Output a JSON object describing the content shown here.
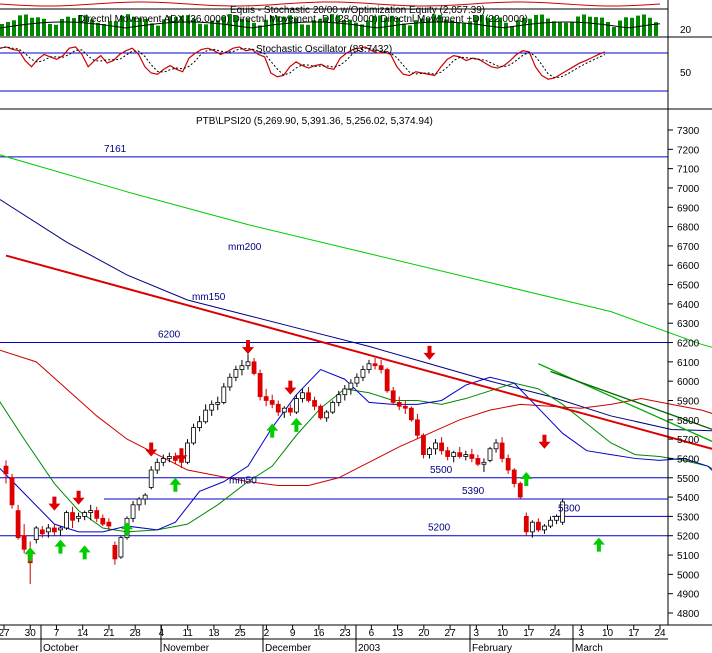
{
  "panels": {
    "equity": {
      "title": "Equis - Stochastic 20/00  w/Optimization Equity (2,057.39)",
      "adx_title": "Directnl Movement ADX (36.0000) Directnl Movement -DI (28.0000) Directnl Movement +DI (22.0000)",
      "tick_label": "20"
    },
    "stochastic": {
      "title": "Stochastic Oscillator (83.7432)",
      "tick_label": "50"
    },
    "price": {
      "title": "PTB\\LPSI20 (5,269.90, 5,391.36, 5,256.02, 5,374.94)"
    }
  },
  "chart_data": {
    "type": "candlestick",
    "title": "PTB\\LPSI20 (5,269.90, 5,391.36, 5,256.02, 5,374.94)",
    "ylim": [
      4750,
      7450
    ],
    "y_ticks": [
      4800,
      4900,
      5000,
      5100,
      5200,
      5300,
      5400,
      5500,
      5600,
      5700,
      5800,
      5900,
      6000,
      6100,
      6200,
      6300,
      6400,
      6500,
      6600,
      6700,
      6800,
      6900,
      7000,
      7100,
      7200,
      7300
    ],
    "x_ticks": [
      "27",
      "30",
      "7",
      "14",
      "21",
      "28",
      "4",
      "11",
      "18",
      "25",
      "2",
      "9",
      "16",
      "23",
      "6",
      "13",
      "20",
      "27",
      "3",
      "10",
      "17",
      "24",
      "3",
      "10",
      "17",
      "24"
    ],
    "x_month_labels": [
      "October",
      "November",
      "December",
      "2003",
      "February",
      "March"
    ],
    "horizontal_levels": [
      {
        "value": 7161,
        "label": "7161"
      },
      {
        "value": 6200,
        "label": "6200"
      },
      {
        "value": 5500,
        "label": "5500"
      },
      {
        "value": 5390,
        "label": "5390"
      },
      {
        "value": 5300,
        "label": "5300"
      },
      {
        "value": 5200,
        "label": "5200"
      }
    ],
    "moving_average_labels": {
      "mm200": "mm200",
      "mm150": "mm150",
      "mm50": "mm50"
    },
    "trendlines": [
      {
        "name": "red",
        "from": [
          0,
          6650
        ],
        "to": [
          140,
          5450
        ]
      },
      {
        "name": "green",
        "from": [
          88,
          6090
        ],
        "to": [
          148,
          5250
        ]
      },
      {
        "name": "dark-green",
        "from": [
          90,
          6050
        ],
        "to": [
          148,
          5400
        ]
      }
    ],
    "mm200": [
      [
        -2,
        7180
      ],
      [
        20,
        6980
      ],
      [
        40,
        6810
      ],
      [
        60,
        6660
      ],
      [
        80,
        6510
      ],
      [
        100,
        6360
      ],
      [
        115,
        6190
      ],
      [
        130,
        6060
      ],
      [
        136,
        5980
      ]
    ],
    "mm150": [
      [
        -2,
        6960
      ],
      [
        10,
        6720
      ],
      [
        20,
        6550
      ],
      [
        30,
        6420
      ],
      [
        40,
        6340
      ],
      [
        50,
        6260
      ],
      [
        60,
        6180
      ],
      [
        70,
        6090
      ],
      [
        80,
        6000
      ],
      [
        90,
        5920
      ],
      [
        100,
        5820
      ],
      [
        110,
        5750
      ],
      [
        120,
        5740
      ],
      [
        130,
        5720
      ],
      [
        140,
        5690
      ]
    ],
    "mm50": [
      [
        -2,
        6170
      ],
      [
        5,
        6100
      ],
      [
        10,
        5960
      ],
      [
        15,
        5820
      ],
      [
        20,
        5700
      ],
      [
        25,
        5620
      ],
      [
        30,
        5540
      ],
      [
        35,
        5510
      ],
      [
        40,
        5480
      ],
      [
        45,
        5460
      ],
      [
        50,
        5460
      ],
      [
        55,
        5500
      ],
      [
        60,
        5580
      ],
      [
        65,
        5660
      ],
      [
        70,
        5730
      ],
      [
        75,
        5800
      ],
      [
        80,
        5850
      ],
      [
        85,
        5880
      ],
      [
        90,
        5870
      ],
      [
        95,
        5860
      ],
      [
        100,
        5880
      ],
      [
        105,
        5910
      ],
      [
        110,
        5880
      ],
      [
        115,
        5850
      ],
      [
        120,
        5800
      ],
      [
        125,
        5780
      ],
      [
        130,
        5760
      ],
      [
        135,
        5720
      ],
      [
        140,
        5670
      ]
    ],
    "ma_short_green": [
      [
        -2,
        5940
      ],
      [
        3,
        5700
      ],
      [
        8,
        5470
      ],
      [
        12,
        5330
      ],
      [
        16,
        5240
      ],
      [
        20,
        5220
      ],
      [
        25,
        5230
      ],
      [
        30,
        5260
      ],
      [
        35,
        5360
      ],
      [
        40,
        5480
      ],
      [
        44,
        5560
      ],
      [
        48,
        5720
      ],
      [
        52,
        5860
      ],
      [
        56,
        5960
      ],
      [
        60,
        5940
      ],
      [
        64,
        5900
      ],
      [
        68,
        5900
      ],
      [
        72,
        5880
      ],
      [
        76,
        5910
      ],
      [
        80,
        5950
      ],
      [
        84,
        5990
      ],
      [
        88,
        5960
      ],
      [
        92,
        5880
      ],
      [
        96,
        5780
      ],
      [
        100,
        5680
      ],
      [
        104,
        5620
      ],
      [
        108,
        5610
      ],
      [
        112,
        5590
      ],
      [
        116,
        5560
      ],
      [
        120,
        5490
      ],
      [
        124,
        5400
      ],
      [
        128,
        5320
      ],
      [
        132,
        5280
      ],
      [
        134,
        5290
      ]
    ],
    "ma_short_blue": [
      [
        -2,
        5580
      ],
      [
        3,
        5420
      ],
      [
        8,
        5260
      ],
      [
        12,
        5220
      ],
      [
        16,
        5220
      ],
      [
        20,
        5250
      ],
      [
        25,
        5230
      ],
      [
        28,
        5270
      ],
      [
        32,
        5430
      ],
      [
        36,
        5480
      ],
      [
        40,
        5560
      ],
      [
        44,
        5760
      ],
      [
        48,
        5930
      ],
      [
        52,
        6060
      ],
      [
        56,
        6010
      ],
      [
        60,
        5890
      ],
      [
        64,
        5880
      ],
      [
        68,
        5880
      ],
      [
        72,
        5900
      ],
      [
        76,
        5980
      ],
      [
        80,
        6020
      ],
      [
        84,
        5990
      ],
      [
        88,
        5860
      ],
      [
        92,
        5730
      ],
      [
        96,
        5640
      ],
      [
        100,
        5620
      ],
      [
        104,
        5600
      ],
      [
        108,
        5590
      ],
      [
        112,
        5600
      ],
      [
        116,
        5560
      ],
      [
        120,
        5440
      ],
      [
        124,
        5330
      ],
      [
        128,
        5250
      ],
      [
        132,
        5310
      ],
      [
        134,
        5340
      ]
    ],
    "candles": [
      [
        5560,
        5590,
        5470,
        5520
      ],
      [
        5500,
        5520,
        5340,
        5360
      ],
      [
        5330,
        5360,
        5180,
        5190
      ],
      [
        5200,
        5260,
        5110,
        5130
      ],
      [
        5110,
        5170,
        4950,
        5060
      ],
      [
        5180,
        5250,
        5160,
        5240
      ],
      [
        5230,
        5250,
        5190,
        5210
      ],
      [
        5220,
        5260,
        5190,
        5240
      ],
      [
        5240,
        5260,
        5200,
        5220
      ],
      [
        5230,
        5250,
        5200,
        5240
      ],
      [
        5240,
        5330,
        5230,
        5320
      ],
      [
        5320,
        5350,
        5240,
        5280
      ],
      [
        5290,
        5320,
        5270,
        5300
      ],
      [
        5300,
        5330,
        5280,
        5320
      ],
      [
        5320,
        5360,
        5280,
        5330
      ],
      [
        5330,
        5350,
        5270,
        5290
      ],
      [
        5290,
        5310,
        5250,
        5260
      ],
      [
        5270,
        5290,
        5230,
        5250
      ],
      [
        5150,
        5170,
        5050,
        5080
      ],
      [
        5090,
        5200,
        5080,
        5190
      ],
      [
        5190,
        5300,
        5180,
        5290
      ],
      [
        5290,
        5380,
        5270,
        5360
      ],
      [
        5360,
        5400,
        5330,
        5390
      ],
      [
        5390,
        5420,
        5360,
        5410
      ],
      [
        5450,
        5560,
        5440,
        5540
      ],
      [
        5540,
        5600,
        5520,
        5580
      ],
      [
        5580,
        5620,
        5560,
        5600
      ],
      [
        5600,
        5630,
        5580,
        5610
      ],
      [
        5610,
        5630,
        5570,
        5590
      ],
      [
        5590,
        5610,
        5550,
        5580
      ],
      [
        5580,
        5700,
        5570,
        5680
      ],
      [
        5680,
        5780,
        5670,
        5760
      ],
      [
        5760,
        5820,
        5740,
        5790
      ],
      [
        5790,
        5880,
        5780,
        5850
      ],
      [
        5850,
        5900,
        5820,
        5880
      ],
      [
        5880,
        5920,
        5850,
        5890
      ],
      [
        5890,
        5990,
        5880,
        5970
      ],
      [
        5970,
        6040,
        5950,
        6020
      ],
      [
        6020,
        6080,
        6000,
        6060
      ],
      [
        6060,
        6110,
        6030,
        6080
      ],
      [
        6080,
        6140,
        6060,
        6100
      ],
      [
        6100,
        6120,
        6030,
        6040
      ],
      [
        6040,
        6060,
        5900,
        5920
      ],
      [
        5920,
        5960,
        5870,
        5900
      ],
      [
        5900,
        5930,
        5860,
        5880
      ],
      [
        5880,
        5900,
        5820,
        5840
      ],
      [
        5840,
        5870,
        5810,
        5860
      ],
      [
        5860,
        5880,
        5820,
        5840
      ],
      [
        5840,
        5930,
        5830,
        5910
      ],
      [
        5910,
        5960,
        5890,
        5940
      ],
      [
        5940,
        5970,
        5890,
        5900
      ],
      [
        5900,
        5920,
        5850,
        5870
      ],
      [
        5870,
        5880,
        5800,
        5810
      ],
      [
        5810,
        5850,
        5790,
        5840
      ],
      [
        5840,
        5900,
        5830,
        5890
      ],
      [
        5890,
        5950,
        5870,
        5930
      ],
      [
        5930,
        5980,
        5900,
        5960
      ],
      [
        5960,
        6010,
        5930,
        5990
      ],
      [
        5990,
        6040,
        5970,
        6020
      ],
      [
        6020,
        6080,
        6000,
        6060
      ],
      [
        6060,
        6110,
        6040,
        6090
      ],
      [
        6090,
        6120,
        6060,
        6080
      ],
      [
        6080,
        6110,
        6040,
        6060
      ],
      [
        6060,
        6070,
        5940,
        5950
      ],
      [
        5950,
        5970,
        5880,
        5890
      ],
      [
        5890,
        5920,
        5850,
        5870
      ],
      [
        5870,
        5900,
        5830,
        5860
      ],
      [
        5860,
        5870,
        5790,
        5800
      ],
      [
        5800,
        5830,
        5700,
        5720
      ],
      [
        5720,
        5730,
        5600,
        5620
      ],
      [
        5620,
        5660,
        5600,
        5650
      ],
      [
        5650,
        5700,
        5620,
        5680
      ],
      [
        5680,
        5710,
        5620,
        5640
      ],
      [
        5640,
        5660,
        5590,
        5610
      ],
      [
        5610,
        5640,
        5580,
        5630
      ],
      [
        5630,
        5660,
        5600,
        5610
      ],
      [
        5610,
        5640,
        5590,
        5620
      ],
      [
        5620,
        5650,
        5580,
        5600
      ],
      [
        5600,
        5620,
        5560,
        5570
      ],
      [
        5570,
        5600,
        5530,
        5580
      ],
      [
        5590,
        5660,
        5580,
        5650
      ],
      [
        5650,
        5700,
        5630,
        5680
      ],
      [
        5680,
        5710,
        5580,
        5600
      ],
      [
        5600,
        5620,
        5520,
        5540
      ],
      [
        5540,
        5550,
        5450,
        5470
      ],
      [
        5470,
        5480,
        5390,
        5400
      ],
      [
        5300,
        5320,
        5200,
        5220
      ],
      [
        5220,
        5280,
        5190,
        5270
      ],
      [
        5270,
        5290,
        5220,
        5230
      ],
      [
        5230,
        5260,
        5210,
        5250
      ],
      [
        5250,
        5300,
        5240,
        5280
      ],
      [
        5280,
        5310,
        5260,
        5300
      ],
      [
        5270,
        5391,
        5256,
        5375
      ]
    ],
    "arrows_up": [
      [
        4,
        5140
      ],
      [
        9,
        5180
      ],
      [
        13,
        5150
      ],
      [
        20,
        5270
      ],
      [
        28,
        5500
      ],
      [
        44,
        5780
      ],
      [
        48,
        5810
      ],
      [
        86,
        5530
      ],
      [
        98,
        5190
      ]
    ],
    "arrows_down": [
      [
        8,
        5330
      ],
      [
        12,
        5360
      ],
      [
        24,
        5610
      ],
      [
        29,
        5580
      ],
      [
        40,
        6140
      ],
      [
        47,
        5930
      ],
      [
        70,
        6110
      ],
      [
        89,
        5650
      ]
    ]
  }
}
